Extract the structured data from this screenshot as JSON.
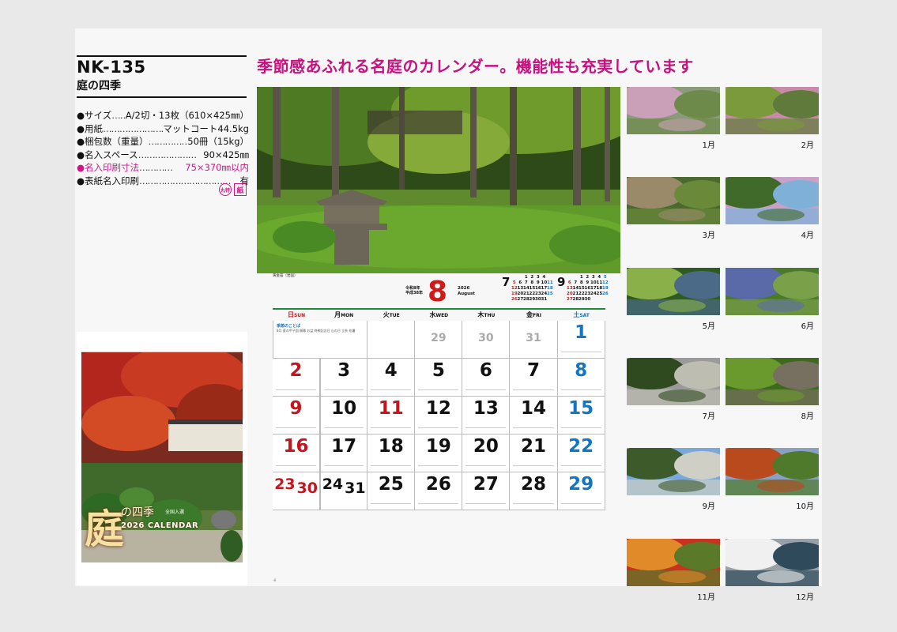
{
  "spec": {
    "code": "NK-135",
    "name": "庭の四季",
    "rows": [
      {
        "label": "●サイズ",
        "dots": "………",
        "value": "A/2切・13枚（610×425㎜）",
        "pink": false
      },
      {
        "label": "●用紙",
        "dots": "……………………………",
        "value": "マットコート44.5kg",
        "pink": false
      },
      {
        "label": "●梱包数（重量）",
        "dots": "…………………",
        "value": "50冊（15kg）",
        "pink": false
      },
      {
        "label": "●名入スペース",
        "dots": "…………………",
        "value": "90×425㎜",
        "pink": false
      },
      {
        "label": "●名入印刷寸法",
        "dots": "…………",
        "value": "75×370㎜以内",
        "pink": true
      },
      {
        "label": "●表紙名入印刷",
        "dots": "……………………………",
        "value": "有",
        "pink": false
      }
    ],
    "badge_circle": "丸特",
    "badge_square": "紙"
  },
  "cover": {
    "title_kanji": "庭",
    "title_rest": "の四季",
    "subtitle": "全国入選",
    "calendar_label": "2026 CALENDAR"
  },
  "headline": "季節感あふれる名庭のカレンダー。機能性も充実しています",
  "calendar": {
    "month": "8",
    "era": [
      "令和8年",
      "平成38年"
    ],
    "year": "2026",
    "month_en": "August",
    "notes_caption": "黄金苔（岩国）",
    "prev": {
      "num": "7",
      "rows": [
        [
          "",
          "",
          "1",
          "2",
          "3",
          "4",
          ""
        ],
        [
          "5",
          "6",
          "7",
          "8",
          "9",
          "10",
          "11"
        ],
        [
          "12",
          "13",
          "14",
          "15",
          "16",
          "17",
          "18"
        ],
        [
          "19",
          "20",
          "21",
          "22",
          "23",
          "24",
          "25"
        ],
        [
          "26",
          "27",
          "28",
          "29",
          "30",
          "31",
          ""
        ]
      ]
    },
    "next": {
      "num": "9",
      "rows": [
        [
          "",
          "",
          "1",
          "2",
          "3",
          "4",
          "5"
        ],
        [
          "6",
          "7",
          "8",
          "9",
          "10",
          "11",
          "12"
        ],
        [
          "13",
          "14",
          "15",
          "16",
          "17",
          "18",
          "19"
        ],
        [
          "20",
          "21",
          "22",
          "23",
          "24",
          "25",
          "26"
        ],
        [
          "27",
          "28",
          "29",
          "30",
          "",
          "",
          ""
        ]
      ]
    },
    "weekdays": [
      {
        "jp": "日",
        "en": "SUN",
        "color": "red"
      },
      {
        "jp": "月",
        "en": "MON",
        "color": ""
      },
      {
        "jp": "火",
        "en": "TUE",
        "color": ""
      },
      {
        "jp": "水",
        "en": "WED",
        "color": ""
      },
      {
        "jp": "木",
        "en": "THU",
        "color": ""
      },
      {
        "jp": "金",
        "en": "FRI",
        "color": ""
      },
      {
        "jp": "土",
        "en": "SAT",
        "color": "blue"
      }
    ],
    "note_text": "8月 夏の甲子園 開幕 お盆 終戦記念日 山の日 立秋 処暑",
    "note_title": "季節のことば",
    "days": [
      {
        "n": "29",
        "c": "grey"
      },
      {
        "n": "30",
        "c": "grey"
      },
      {
        "n": "31",
        "c": "grey"
      },
      {
        "n": "1",
        "c": "blue"
      },
      {
        "n": "2",
        "c": "red"
      },
      {
        "n": "3",
        "c": ""
      },
      {
        "n": "4",
        "c": ""
      },
      {
        "n": "5",
        "c": ""
      },
      {
        "n": "6",
        "c": ""
      },
      {
        "n": "7",
        "c": ""
      },
      {
        "n": "8",
        "c": "blue"
      },
      {
        "n": "9",
        "c": "red"
      },
      {
        "n": "10",
        "c": ""
      },
      {
        "n": "11",
        "c": "red"
      },
      {
        "n": "12",
        "c": ""
      },
      {
        "n": "13",
        "c": ""
      },
      {
        "n": "14",
        "c": ""
      },
      {
        "n": "15",
        "c": "blue"
      },
      {
        "n": "16",
        "c": "red"
      },
      {
        "n": "17",
        "c": ""
      },
      {
        "n": "18",
        "c": ""
      },
      {
        "n": "19",
        "c": ""
      },
      {
        "n": "20",
        "c": ""
      },
      {
        "n": "21",
        "c": ""
      },
      {
        "n": "22",
        "c": "blue"
      },
      {
        "n": "25",
        "c": ""
      },
      {
        "n": "26",
        "c": ""
      },
      {
        "n": "27",
        "c": ""
      },
      {
        "n": "28",
        "c": ""
      },
      {
        "n": "29",
        "c": "blue"
      }
    ],
    "dual_red": [
      "23",
      "30"
    ],
    "dual_black": [
      "24",
      "31"
    ]
  },
  "thumbs": [
    "1月",
    "2月",
    "3月",
    "4月",
    "5月",
    "6月",
    "7月",
    "8月",
    "9月",
    "10月",
    "11月",
    "12月"
  ],
  "page_number": "-8"
}
